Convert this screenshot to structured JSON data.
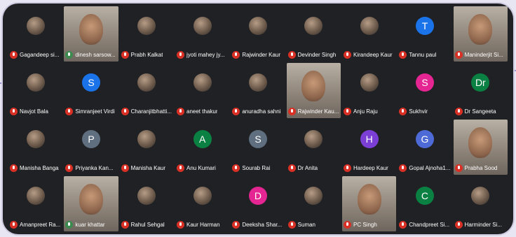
{
  "participants": [
    {
      "name": "Gagandeep si...",
      "initial": "",
      "avatar": "photo",
      "video": false,
      "muted": true
    },
    {
      "name": "dinesh sarsow...",
      "initial": "",
      "avatar": "video",
      "video": true,
      "muted": false,
      "active": true
    },
    {
      "name": "Prabh Kalkat",
      "initial": "",
      "avatar": "photo",
      "video": false,
      "muted": true
    },
    {
      "name": "jyoti mahey jy...",
      "initial": "",
      "avatar": "photo",
      "video": false,
      "muted": true
    },
    {
      "name": "Rajwinder Kaur",
      "initial": "",
      "avatar": "photo",
      "video": false,
      "muted": true
    },
    {
      "name": "Devinder Singh",
      "initial": "",
      "avatar": "photo",
      "video": false,
      "muted": true
    },
    {
      "name": "Kirandeep Kaur",
      "initial": "",
      "avatar": "photo",
      "video": false,
      "muted": true
    },
    {
      "name": "Tannu paul",
      "initial": "T",
      "avatar": "#1a73e8",
      "video": false,
      "muted": true
    },
    {
      "name": "Maninderjit Si...",
      "initial": "",
      "avatar": "video",
      "video": true,
      "muted": true
    },
    {
      "name": "Navjot Bala",
      "initial": "",
      "avatar": "photo",
      "video": false,
      "muted": true
    },
    {
      "name": "Simranjeet Virdi",
      "initial": "S",
      "avatar": "#1a73e8",
      "video": false,
      "muted": true
    },
    {
      "name": "Charanjitbhatti...",
      "initial": "",
      "avatar": "photo",
      "video": false,
      "muted": true
    },
    {
      "name": "aneet thakur",
      "initial": "",
      "avatar": "photo",
      "video": false,
      "muted": true
    },
    {
      "name": "anuradha sahni",
      "initial": "",
      "avatar": "photo",
      "video": false,
      "muted": true
    },
    {
      "name": "Rajwinder Kau...",
      "initial": "",
      "avatar": "video",
      "video": true,
      "muted": true
    },
    {
      "name": "Anju Raju",
      "initial": "",
      "avatar": "photo",
      "video": false,
      "muted": true
    },
    {
      "name": "Sukhvir",
      "initial": "S",
      "avatar": "#e52592",
      "video": false,
      "muted": true
    },
    {
      "name": "Dr Sangeeta",
      "initial": "Dr",
      "avatar": "#0b8043",
      "video": false,
      "muted": true
    },
    {
      "name": "Manisha Banga",
      "initial": "",
      "avatar": "photo",
      "video": false,
      "muted": true
    },
    {
      "name": "Priyanka Kan...",
      "initial": "P",
      "avatar": "#5f6f7f",
      "video": false,
      "muted": true
    },
    {
      "name": "Manisha Kaur",
      "initial": "",
      "avatar": "photo",
      "video": false,
      "muted": true
    },
    {
      "name": "Anu Kumari",
      "initial": "A",
      "avatar": "#0b8043",
      "video": false,
      "muted": true
    },
    {
      "name": "Sourab Rai",
      "initial": "S",
      "avatar": "#5f6f7f",
      "video": false,
      "muted": true
    },
    {
      "name": "Dr Anita",
      "initial": "",
      "avatar": "photo",
      "video": false,
      "muted": true
    },
    {
      "name": "Hardeep Kaur",
      "initial": "H",
      "avatar": "#7b3fd6",
      "video": false,
      "muted": true
    },
    {
      "name": "Gopal Ajnoha1...",
      "initial": "G",
      "avatar": "#4e6ad6",
      "video": false,
      "muted": true
    },
    {
      "name": "Prabha Sood",
      "initial": "",
      "avatar": "video",
      "video": true,
      "muted": true
    },
    {
      "name": "Amanpreet Ra...",
      "initial": "",
      "avatar": "photo",
      "video": false,
      "muted": true
    },
    {
      "name": "kuar khattar",
      "initial": "",
      "avatar": "video",
      "video": true,
      "muted": false
    },
    {
      "name": "Rahul Sehgal",
      "initial": "",
      "avatar": "photo",
      "video": false,
      "muted": true
    },
    {
      "name": "Kaur Harman",
      "initial": "",
      "avatar": "photo",
      "video": false,
      "muted": true
    },
    {
      "name": "Deeksha Shar...",
      "initial": "D",
      "avatar": "#e52592",
      "video": false,
      "muted": true
    },
    {
      "name": "Suman",
      "initial": "",
      "avatar": "photo",
      "video": false,
      "muted": true
    },
    {
      "name": "PC Singh",
      "initial": "",
      "avatar": "video",
      "video": true,
      "muted": true
    },
    {
      "name": "Chandpreet Si...",
      "initial": "C",
      "avatar": "#0b8043",
      "video": false,
      "muted": true
    },
    {
      "name": "Harminder Si...",
      "initial": "",
      "avatar": "photo",
      "video": false,
      "muted": true
    }
  ],
  "icons": {
    "mic": "mic-off-icon"
  },
  "colors": {
    "background": "#202124",
    "muted_badge": "#d93025"
  }
}
